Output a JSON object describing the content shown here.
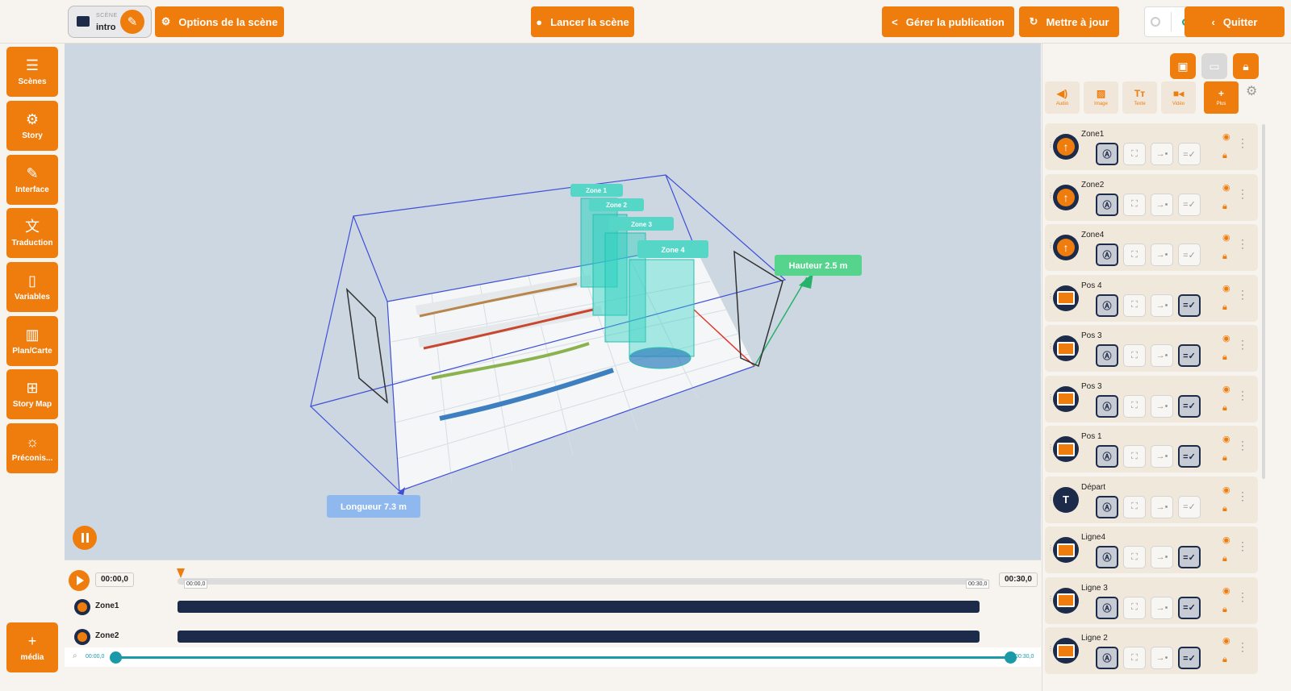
{
  "header": {
    "scene_label": "SCÈNE",
    "scene_value": "intro",
    "options_label": "Options de la scène",
    "launch_label": "Lancer la scène",
    "publish_label": "Gérer la publication",
    "update_label": "Mettre à jour",
    "quit_label": "Quitter"
  },
  "sidebar": {
    "items": [
      {
        "label": "Scènes",
        "icon": "menu-icon"
      },
      {
        "label": "Story",
        "icon": "gear-icon"
      },
      {
        "label": "Interface",
        "icon": "brush-icon"
      },
      {
        "label": "Traduction",
        "icon": "translate-icon"
      },
      {
        "label": "Variables",
        "icon": "bookmark-icon"
      },
      {
        "label": "Plan/Carte",
        "icon": "map-icon"
      },
      {
        "label": "Story Map",
        "icon": "flow-icon"
      },
      {
        "label": "Préconis...",
        "icon": "lightbulb-icon"
      }
    ],
    "media_label": "média"
  },
  "viewport": {
    "zones": [
      "Zone 1",
      "Zone 2",
      "Zone 3",
      "Zone 4"
    ],
    "height_label": "Hauteur 2.5 m",
    "length_label": "Longueur 7.3 m"
  },
  "timeline": {
    "current_time": "00:00,0",
    "total_time": "00:30,0",
    "ruler_start": "00:00,0",
    "ruler_end": "00:30,0",
    "tracks": [
      {
        "name": "Zone1"
      },
      {
        "name": "Zone2"
      }
    ],
    "zoom_start": "00:00,0",
    "zoom_end": "00:30,0"
  },
  "media_tabs": [
    {
      "label": "Audio",
      "icon": "speaker-icon"
    },
    {
      "label": "Image",
      "icon": "image-icon"
    },
    {
      "label": "Texte",
      "icon": "text-icon"
    },
    {
      "label": "Vidéo",
      "icon": "video-icon"
    },
    {
      "label": "Plus",
      "icon": "plus-icon"
    }
  ],
  "layers": [
    {
      "name": "Zone1",
      "type": "zone",
      "last_on": false
    },
    {
      "name": "Zone2",
      "type": "zone",
      "last_on": false
    },
    {
      "name": "Zone4",
      "type": "zone",
      "last_on": false
    },
    {
      "name": "Pos 4",
      "type": "image",
      "last_on": true
    },
    {
      "name": "Pos 3",
      "type": "image",
      "last_on": true
    },
    {
      "name": "Pos 3",
      "type": "image",
      "last_on": true
    },
    {
      "name": "Pos 1",
      "type": "image",
      "last_on": true
    },
    {
      "name": "Départ",
      "type": "text",
      "last_on": false
    },
    {
      "name": "Ligne4",
      "type": "image",
      "last_on": true
    },
    {
      "name": "Ligne 3",
      "type": "image",
      "last_on": true
    },
    {
      "name": "Ligne 2",
      "type": "image",
      "last_on": true
    }
  ],
  "colors": {
    "accent": "#ef7d0e",
    "navy": "#1d2b4a",
    "teal": "#1a9aa9"
  }
}
